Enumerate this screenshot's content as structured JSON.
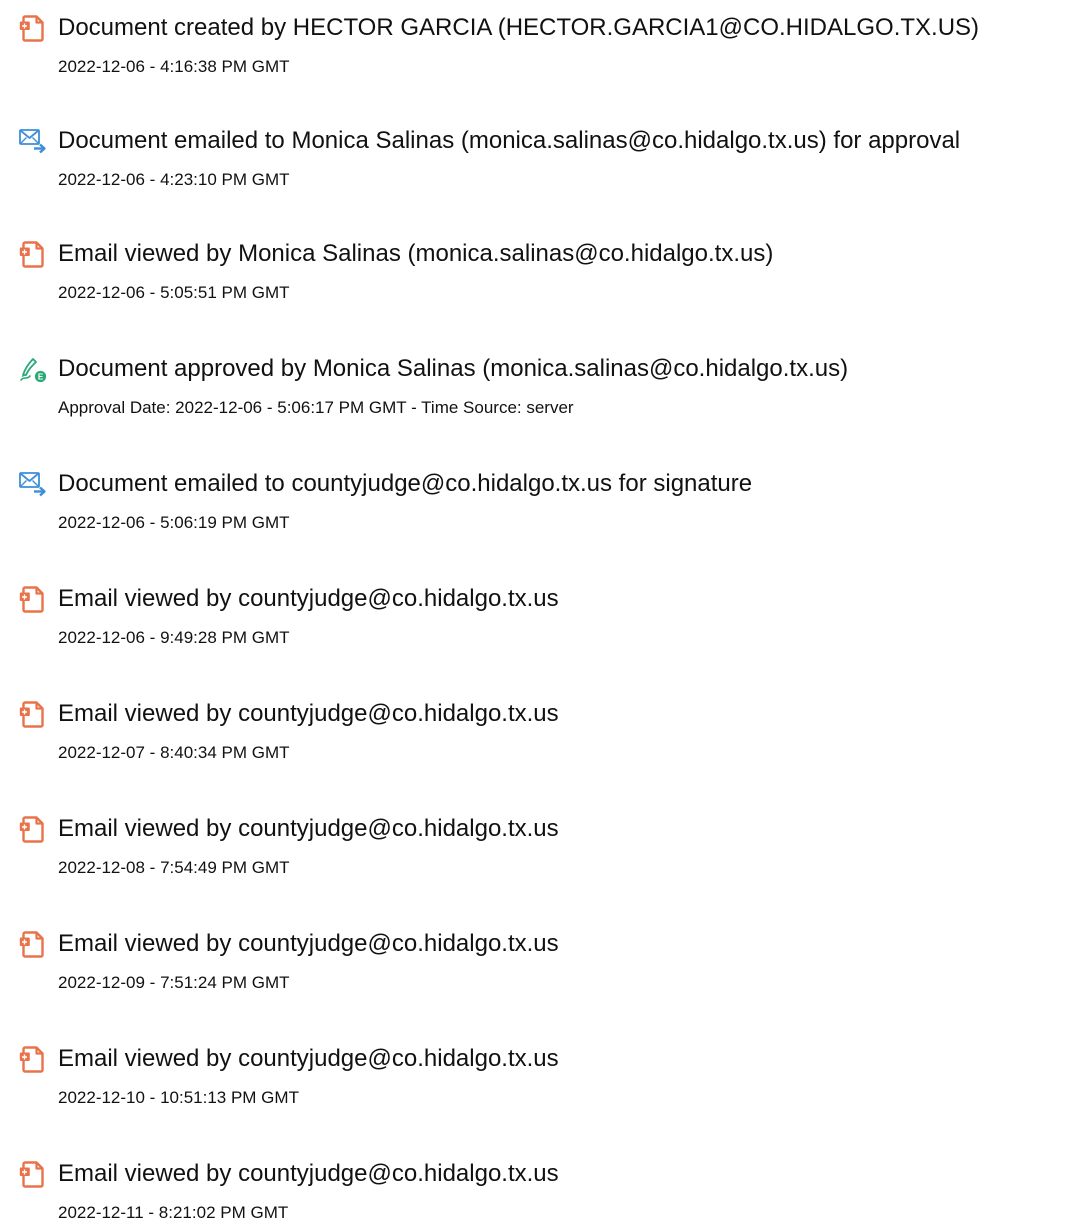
{
  "entries": [
    {
      "icon": "document-pdf-icon",
      "title": "Document created by HECTOR GARCIA (HECTOR.GARCIA1@CO.HIDALGO.TX.US)",
      "detail": "2022-12-06 - 4:16:38 PM GMT"
    },
    {
      "icon": "email-sent-icon",
      "title": "Document emailed to Monica Salinas (monica.salinas@co.hidalgo.tx.us) for approval",
      "detail": "2022-12-06 - 4:23:10 PM GMT"
    },
    {
      "icon": "document-pdf-icon",
      "title": "Email viewed by Monica Salinas (monica.salinas@co.hidalgo.tx.us)",
      "detail": "2022-12-06 - 5:05:51 PM GMT"
    },
    {
      "icon": "approval-pen-icon",
      "title": "Document approved by Monica Salinas (monica.salinas@co.hidalgo.tx.us)",
      "detail": "Approval Date: 2022-12-06 - 5:06:17 PM GMT - Time Source: server"
    },
    {
      "icon": "email-sent-icon",
      "title": "Document emailed to countyjudge@co.hidalgo.tx.us for signature",
      "detail": "2022-12-06 - 5:06:19 PM GMT"
    },
    {
      "icon": "document-pdf-icon",
      "title": "Email viewed by countyjudge@co.hidalgo.tx.us",
      "detail": "2022-12-06 - 9:49:28 PM GMT"
    },
    {
      "icon": "document-pdf-icon",
      "title": "Email viewed by countyjudge@co.hidalgo.tx.us",
      "detail": "2022-12-07 - 8:40:34 PM GMT"
    },
    {
      "icon": "document-pdf-icon",
      "title": "Email viewed by countyjudge@co.hidalgo.tx.us",
      "detail": "2022-12-08 - 7:54:49 PM GMT"
    },
    {
      "icon": "document-pdf-icon",
      "title": "Email viewed by countyjudge@co.hidalgo.tx.us",
      "detail": "2022-12-09 - 7:51:24 PM GMT"
    },
    {
      "icon": "document-pdf-icon",
      "title": "Email viewed by countyjudge@co.hidalgo.tx.us",
      "detail": "2022-12-10 - 10:51:13 PM GMT"
    },
    {
      "icon": "document-pdf-icon",
      "title": "Email viewed by countyjudge@co.hidalgo.tx.us",
      "detail": "2022-12-11 - 8:21:02 PM GMT"
    }
  ],
  "colors": {
    "document_icon": "#e8734a",
    "email_icon": "#3e8fd8",
    "approval_icon": "#2aa876",
    "text": "#111111"
  }
}
